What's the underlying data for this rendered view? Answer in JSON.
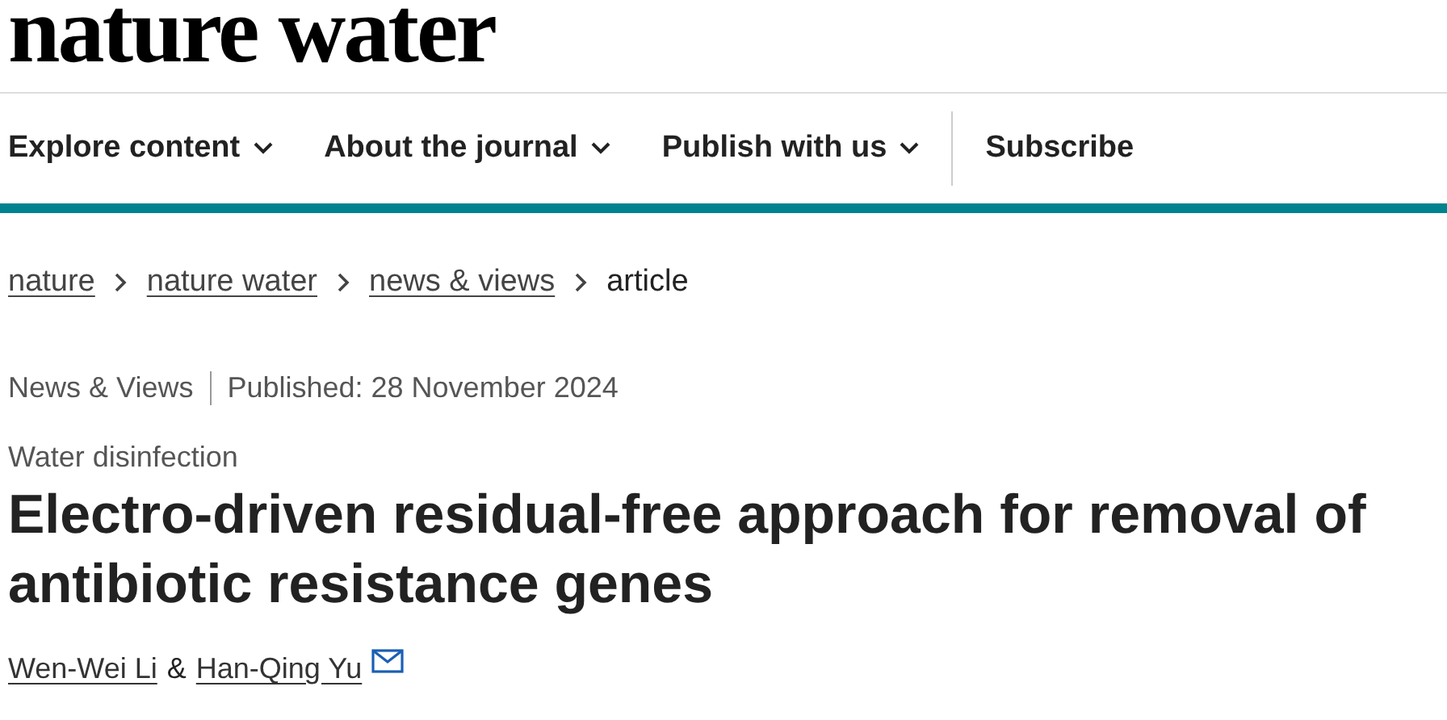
{
  "logo": "nature water",
  "nav": [
    {
      "label": "Explore content",
      "dropdown": true
    },
    {
      "label": "About the journal",
      "dropdown": true
    },
    {
      "label": "Publish with us",
      "dropdown": true
    },
    {
      "label": "Subscribe",
      "dropdown": false
    }
  ],
  "breadcrumb": [
    {
      "label": "nature",
      "link": true
    },
    {
      "label": "nature water",
      "link": true
    },
    {
      "label": "news & views",
      "link": true
    },
    {
      "label": "article",
      "link": false
    }
  ],
  "article_type": "News & Views",
  "published": "Published: 28 November 2024",
  "subject": "Water disinfection",
  "title": "Electro-driven residual-free approach for removal of antibiotic resistance genes",
  "authors": [
    {
      "name": "Wen-Wei Li",
      "email": false
    },
    {
      "name": "Han-Qing Yu",
      "email": true
    }
  ],
  "author_separator": "&"
}
